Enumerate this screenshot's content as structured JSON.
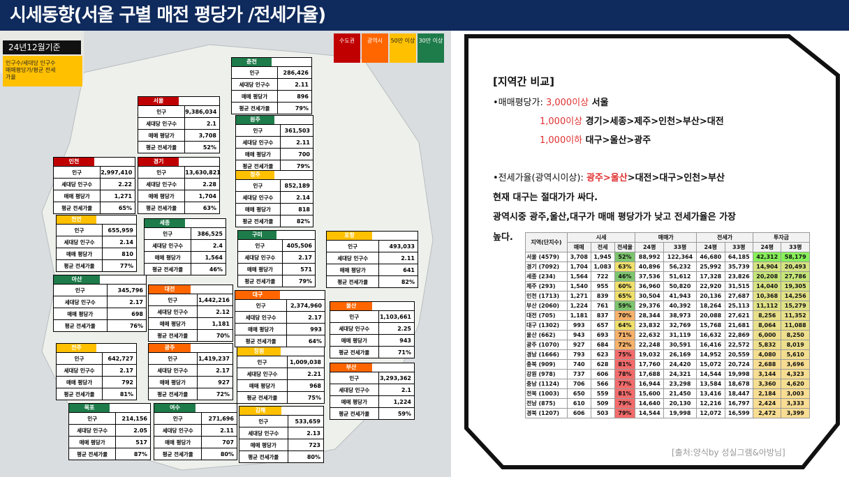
{
  "title": "시세동향(서울 구별 매전 평당가 /전세가율)",
  "date_label": "24년12월기준",
  "legend_note": [
    "인구수/세대당 인구수",
    "매매평당가/평균 전세",
    "가율"
  ],
  "categories": [
    {
      "label": "수도권",
      "color": "#c00000"
    },
    {
      "label": "광역시",
      "color": "#ff6600"
    },
    {
      "label": "50만 이상",
      "color": "#ffc000"
    },
    {
      "label": "30만 이상",
      "color": "#1e7b4a"
    }
  ],
  "row_labels": {
    "pop": "인구",
    "hh": "세대당 인구수",
    "price": "매매 평당가",
    "ratio": "평균 전세가율"
  },
  "cards": [
    {
      "id": "chuncheon",
      "name": "춘천",
      "color": "#1e7b4a",
      "pop": "286,426",
      "hh": "2.11",
      "price": "896",
      "ratio": "79%"
    },
    {
      "id": "seoul",
      "name": "서울",
      "color": "#c00000",
      "pop": "9,386,034",
      "hh": "2.1",
      "price": "3,708",
      "ratio": "52%"
    },
    {
      "id": "wonju",
      "name": "원주",
      "color": "#1e7b4a",
      "pop": "361,503",
      "hh": "2.11",
      "price": "700",
      "ratio": "79%"
    },
    {
      "id": "cheongju",
      "name": "청주",
      "color": "#ffc000",
      "pop": "852,189",
      "hh": "2.14",
      "price": "818",
      "ratio": "82%"
    },
    {
      "id": "incheon",
      "name": "인천",
      "color": "#c00000",
      "pop": "2,997,410",
      "hh": "2.22",
      "price": "1,271",
      "ratio": "65%"
    },
    {
      "id": "gyeonggi",
      "name": "경기",
      "color": "#c00000",
      "pop": "13,630,821",
      "hh": "2.28",
      "price": "1,704",
      "ratio": "63%"
    },
    {
      "id": "cheonan",
      "name": "천안",
      "color": "#ffc000",
      "pop": "655,959",
      "hh": "2.14",
      "price": "810",
      "ratio": "77%"
    },
    {
      "id": "sejong",
      "name": "세종",
      "color": "#1e7b4a",
      "pop": "386,525",
      "hh": "2.4",
      "price": "1,564",
      "ratio": "46%"
    },
    {
      "id": "gumi",
      "name": "구미",
      "color": "#1e7b4a",
      "pop": "405,506",
      "hh": "2.17",
      "price": "571",
      "ratio": "79%"
    },
    {
      "id": "pohang",
      "name": "포항",
      "color": "#ffc000",
      "pop": "493,033",
      "hh": "2.11",
      "price": "641",
      "ratio": "82%"
    },
    {
      "id": "asan",
      "name": "아산",
      "color": "#1e7b4a",
      "pop": "345,796",
      "hh": "2.17",
      "price": "698",
      "ratio": "76%"
    },
    {
      "id": "daejeon",
      "name": "대전",
      "color": "#ff6600",
      "pop": "1,442,216",
      "hh": "2.12",
      "price": "1,181",
      "ratio": "70%"
    },
    {
      "id": "daegu",
      "name": "대구",
      "color": "#ff6600",
      "pop": "2,374,960",
      "hh": "2.17",
      "price": "993",
      "ratio": "64%"
    },
    {
      "id": "ulsan",
      "name": "울산",
      "color": "#ff6600",
      "pop": "1,103,661",
      "hh": "2.25",
      "price": "943",
      "ratio": "71%"
    },
    {
      "id": "jeonju",
      "name": "전주",
      "color": "#ffc000",
      "pop": "642,727",
      "hh": "2.17",
      "price": "792",
      "ratio": "81%"
    },
    {
      "id": "gwangju",
      "name": "광주",
      "color": "#ff6600",
      "pop": "1,419,237",
      "hh": "2.17",
      "price": "927",
      "ratio": "72%"
    },
    {
      "id": "changwon",
      "name": "창원",
      "color": "#ffc000",
      "pop": "1,009,038",
      "hh": "2.21",
      "price": "968",
      "ratio": "75%"
    },
    {
      "id": "busan",
      "name": "부산",
      "color": "#ff6600",
      "pop": "3,293,362",
      "hh": "2.1",
      "price": "1,224",
      "ratio": "59%"
    },
    {
      "id": "mokpo",
      "name": "목포",
      "color": "#1e7b4a",
      "pop": "214,156",
      "hh": "2.05",
      "price": "517",
      "ratio": "87%"
    },
    {
      "id": "yeosu",
      "name": "여수",
      "color": "#1e7b4a",
      "pop": "271,696",
      "hh": "2.11",
      "price": "707",
      "ratio": "80%"
    },
    {
      "id": "gimhae",
      "name": "김해",
      "color": "#ffc000",
      "pop": "533,659",
      "hh": "2.13",
      "price": "723",
      "ratio": "80%"
    }
  ],
  "panel": {
    "heading": "[지역간 비교]",
    "l1a": "•매매평당가: ",
    "l1b": "3,000이상",
    "l1c": " 서울",
    "l2a": "1,000이상",
    "l2b": " 경기>세종>제주>인천>부산>대전",
    "l3a": "1,000이하",
    "l3b": " 대구>울산>광주",
    "l4a": "•전세가율(광역시이상): ",
    "l4b": "광주>울산",
    "l4c": ">대전>대구>인천>부산",
    "l5": "현재 대구는 절대가가 싸다.",
    "l6": "광역시중 광주,울산,대구가 매매 평당가가 낮고 전세가율은 가장",
    "l7": "높다."
  },
  "table": {
    "h_region": "지역(단지수)",
    "h_groups": [
      "시세",
      "매매가",
      "전세가",
      "투자금"
    ],
    "h_sub": [
      "매매",
      "전세",
      "전세율",
      "24평",
      "33평",
      "24평",
      "33평",
      "24평",
      "33평"
    ],
    "rows": [
      [
        "서울 (4579)",
        "3,708",
        "1,945",
        "52%",
        "88,992",
        "122,364",
        "46,680",
        "64,185",
        "42,312",
        "58,179"
      ],
      [
        "경기 (7092)",
        "1,704",
        "1,083",
        "63%",
        "40,896",
        "56,232",
        "25,992",
        "35,739",
        "14,904",
        "20,493"
      ],
      [
        "세종 (234)",
        "1,564",
        "722",
        "46%",
        "37,536",
        "51,612",
        "17,328",
        "23,826",
        "20,208",
        "27,786"
      ],
      [
        "제주 (293)",
        "1,540",
        "955",
        "60%",
        "36,960",
        "50,820",
        "22,920",
        "31,515",
        "14,040",
        "19,305"
      ],
      [
        "인천 (1713)",
        "1,271",
        "839",
        "65%",
        "30,504",
        "41,943",
        "20,136",
        "27,687",
        "10,368",
        "14,256"
      ],
      [
        "부산 (2060)",
        "1,224",
        "761",
        "59%",
        "29,376",
        "40,392",
        "18,264",
        "25,113",
        "11,112",
        "15,279"
      ],
      [
        "대전 (705)",
        "1,181",
        "837",
        "70%",
        "28,344",
        "38,973",
        "20,088",
        "27,621",
        "8,256",
        "11,352"
      ],
      [
        "대구 (1302)",
        "993",
        "657",
        "64%",
        "23,832",
        "32,769",
        "15,768",
        "21,681",
        "8,064",
        "11,088"
      ],
      [
        "울산 (662)",
        "943",
        "693",
        "71%",
        "22,632",
        "31,119",
        "16,632",
        "22,869",
        "6,000",
        "8,250"
      ],
      [
        "광주 (1070)",
        "927",
        "684",
        "72%",
        "22,248",
        "30,591",
        "16,416",
        "22,572",
        "5,832",
        "8,019"
      ],
      [
        "경남 (1666)",
        "793",
        "623",
        "75%",
        "19,032",
        "26,169",
        "14,952",
        "20,559",
        "4,080",
        "5,610"
      ],
      [
        "충북 (909)",
        "740",
        "628",
        "81%",
        "17,760",
        "24,420",
        "15,072",
        "20,724",
        "2,688",
        "3,696"
      ],
      [
        "강원 (978)",
        "737",
        "606",
        "78%",
        "17,688",
        "24,321",
        "14,544",
        "19,998",
        "3,144",
        "4,323"
      ],
      [
        "충남 (1124)",
        "706",
        "566",
        "77%",
        "16,944",
        "23,298",
        "13,584",
        "18,678",
        "3,360",
        "4,620"
      ],
      [
        "전북 (1003)",
        "650",
        "559",
        "81%",
        "15,600",
        "21,450",
        "13,416",
        "18,447",
        "2,184",
        "3,003"
      ],
      [
        "전남 (875)",
        "610",
        "509",
        "79%",
        "14,640",
        "20,130",
        "12,216",
        "16,797",
        "2,424",
        "3,333"
      ],
      [
        "경북 (1207)",
        "606",
        "503",
        "79%",
        "14,544",
        "19,998",
        "12,072",
        "16,599",
        "2,472",
        "3,399"
      ]
    ]
  },
  "source": "[출처:양식by 성실그램&아방님]"
}
